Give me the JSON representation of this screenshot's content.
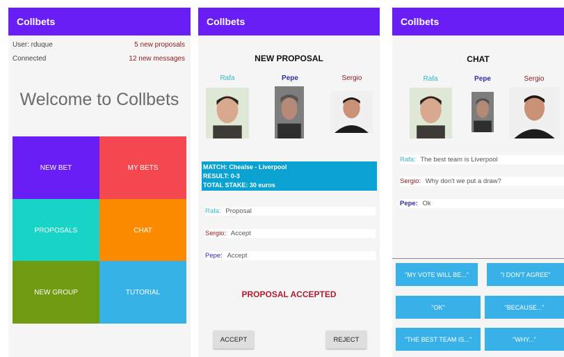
{
  "home": {
    "app_title": "Collbets",
    "user": "User: rduque",
    "connection": "Connected",
    "proposals": "5 new proposals",
    "messages": "12 new messages",
    "welcome": "Welcome to Collbets",
    "tiles": [
      {
        "label": "NEW BET",
        "color": "#6a1ef6"
      },
      {
        "label": "MY BETS",
        "color": "#f4474f"
      },
      {
        "label": "PROPOSALS",
        "color": "#18d4c6"
      },
      {
        "label": "CHAT",
        "color": "#fb8a00"
      },
      {
        "label": "NEW GROUP",
        "color": "#6e9b10"
      },
      {
        "label": "TUTORIAL",
        "color": "#37b2e6"
      }
    ]
  },
  "proposal": {
    "app_title": "Collbets",
    "title": "NEW PROPOSAL",
    "participants": [
      "Rafa",
      "Pepe",
      "Sergio"
    ],
    "match": "MATCH: Chealse - Liverpool",
    "result": "RESULT: 0-3",
    "stake": "TOTAL STAKE: 30 euros",
    "votes": [
      {
        "name": "Rafa:",
        "status": "Proposal"
      },
      {
        "name": "Sergio:",
        "status": "Accept"
      },
      {
        "name": "Pepe:",
        "status": "Accept"
      }
    ],
    "result_status": "PROPOSAL ACCEPTED",
    "accept_label": "ACCEPT",
    "reject_label": "REJECT"
  },
  "chat": {
    "app_title": "Collbets",
    "title": "CHAT",
    "participants": [
      "Rafa",
      "Pepe",
      "Sergio"
    ],
    "messages": [
      {
        "name": "Rafa:",
        "text": "The best team is Liverpool"
      },
      {
        "name": "Sergio:",
        "text": "Why don't we put a draw?"
      },
      {
        "name": "Pepe:",
        "text": "Ok"
      }
    ],
    "quick_replies": [
      "\"MY VOTE WILL BE...\"",
      "\"I DON'T AGREE\"",
      "\"OK\"",
      "\"BECAUSE...\"",
      "\"THE BEST TEAM IS...\"",
      "\"WHY...\""
    ]
  }
}
